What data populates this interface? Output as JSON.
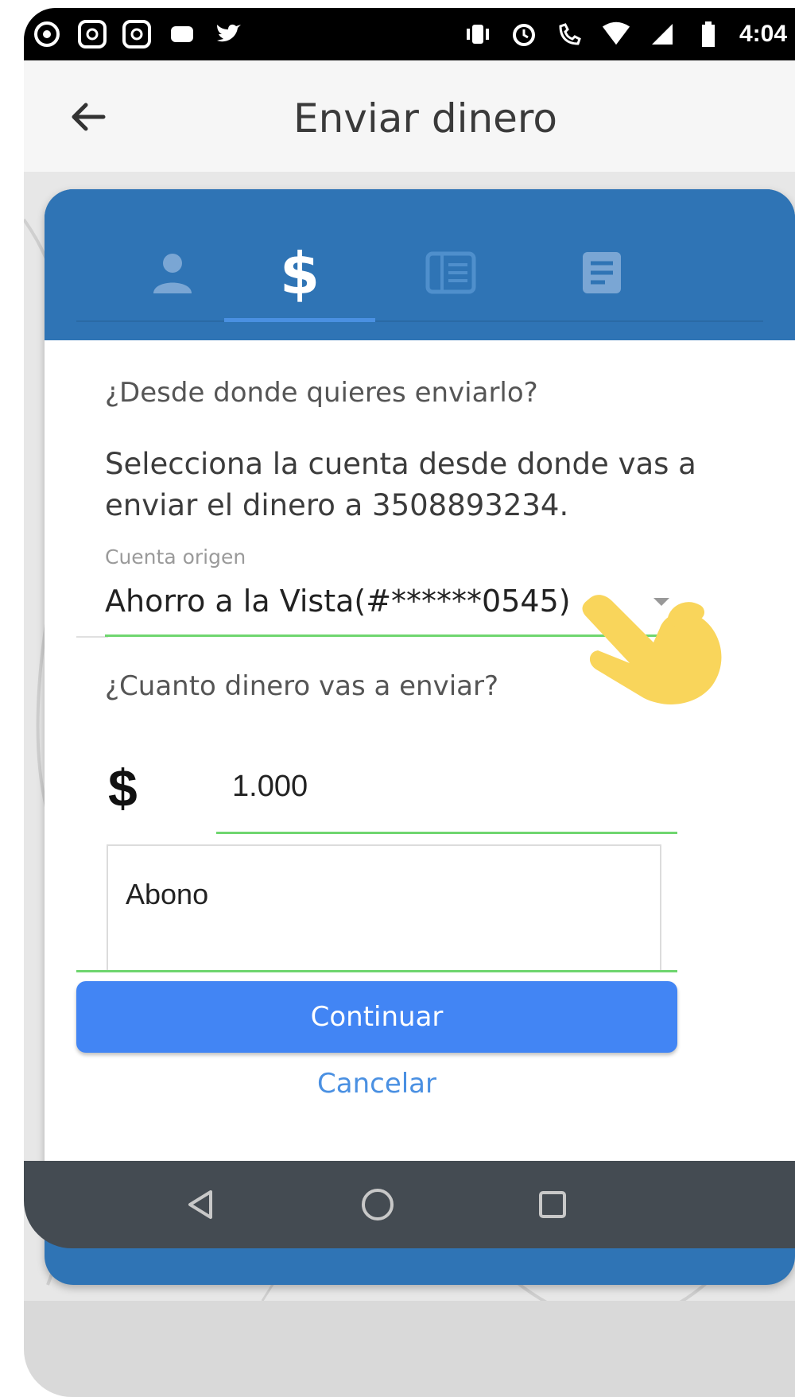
{
  "status_bar": {
    "left_icons": [
      "whatsapp-icon",
      "instagram-icon",
      "instagram-icon",
      "vk-icon",
      "twitter-icon"
    ],
    "right_icons": [
      "vibrate-icon",
      "alarm-icon",
      "hd-call-icon",
      "wifi-icon",
      "signal-icon",
      "battery-icon"
    ],
    "time": "4:04"
  },
  "app_bar": {
    "title": "Enviar dinero"
  },
  "tabs": [
    {
      "name": "person-icon",
      "active": false
    },
    {
      "name": "dollar-icon",
      "active": true
    },
    {
      "name": "receipt-icon",
      "active": false
    },
    {
      "name": "document-icon",
      "active": false
    }
  ],
  "form": {
    "question_origin": "¿Desde donde quieres enviarlo?",
    "description": "Selecciona la cuenta desde donde vas a enviar el dinero a 3508893234.",
    "account_label": "Cuenta origen",
    "account_value": "Ahorro a la Vista(#******0545)",
    "question_amount": "¿Cuanto dinero vas a enviar?",
    "currency_symbol": "$",
    "amount_value": "1.000",
    "note_value": "Abono"
  },
  "actions": {
    "continue_label": "Continuar",
    "cancel_label": "Cancelar"
  },
  "colors": {
    "brand_blue": "#2f74b5",
    "button_blue": "#4285f4",
    "focus_green": "#6fd66f",
    "hand_yellow": "#f9d55b"
  }
}
